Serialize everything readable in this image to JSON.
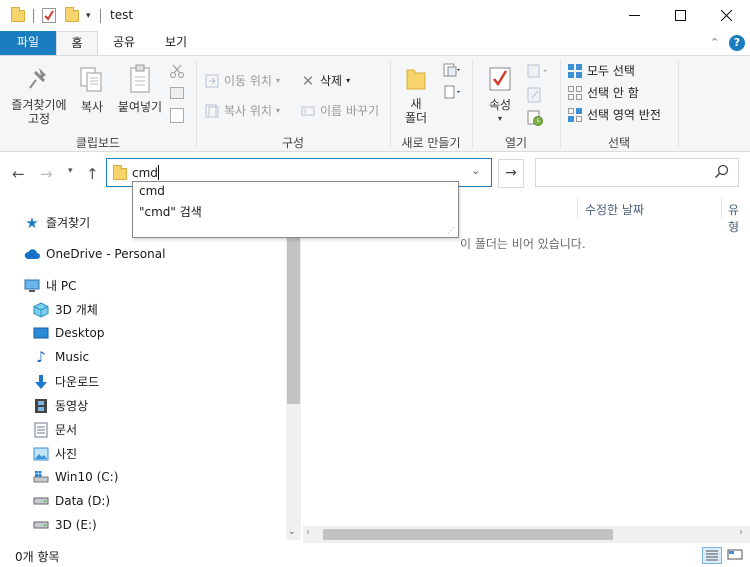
{
  "window": {
    "title": "test",
    "controls": {
      "minimize": "—",
      "maximize": "☐",
      "close": "✕"
    }
  },
  "ribbon_tabs": {
    "file": "파일",
    "home": "홈",
    "share": "공유",
    "view": "보기"
  },
  "ribbon": {
    "clipboard": {
      "pin_label_1": "즐겨찾기에",
      "pin_label_2": "고정",
      "copy": "복사",
      "paste": "붙여넣기",
      "group": "클립보드"
    },
    "organize": {
      "move_to": "이동 위치",
      "copy_to": "복사 위치",
      "delete": "삭제",
      "rename": "이름 바꾸기",
      "group": "구성"
    },
    "new": {
      "new_folder_1": "새",
      "new_folder_2": "폴더",
      "group": "새로 만들기"
    },
    "open": {
      "properties": "속성",
      "group": "열기"
    },
    "select": {
      "select_all": "모두 선택",
      "select_none": "선택 안 함",
      "invert": "선택 영역 반전",
      "group": "선택"
    }
  },
  "address": {
    "value": "cmd",
    "search_placeholder": ""
  },
  "suggestions": [
    "cmd",
    "\"cmd\" 검색"
  ],
  "nav": {
    "quick_access": "즐겨찾기",
    "onedrive": "OneDrive - Personal",
    "this_pc": "내 PC",
    "items": [
      "3D 개체",
      "Desktop",
      "Music",
      "다운로드",
      "동영상",
      "문서",
      "사진",
      "Win10 (C:)",
      "Data (D:)",
      "3D (E:)"
    ]
  },
  "content": {
    "col_date": "수정한 날짜",
    "col_type": "유형",
    "empty_message": "이 폴더는 비어 있습니다."
  },
  "status": {
    "item_count": "0개 항목"
  },
  "colors": {
    "accent": "#1a7dbf",
    "folder": "#f7d46b"
  }
}
